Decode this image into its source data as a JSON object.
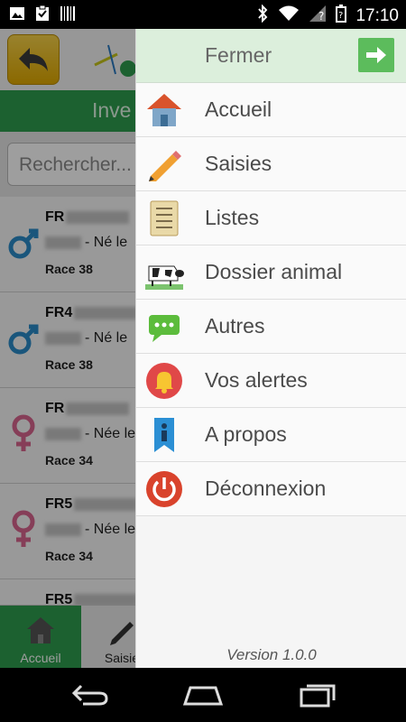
{
  "status_bar": {
    "time": "17:10",
    "left_icons": [
      "photo-icon",
      "clipboard-check-icon",
      "barcode-icon"
    ],
    "right_icons": [
      "bluetooth-icon",
      "wifi-icon",
      "signal-unknown-icon",
      "battery-unknown-icon"
    ]
  },
  "background_app": {
    "section_title": "Inve",
    "search_placeholder": "Rechercher...",
    "animals": [
      {
        "id_prefix": "FR",
        "birth": "- Né le",
        "race": "Race 38",
        "sex": "male"
      },
      {
        "id_prefix": "FR4",
        "birth": "- Né le",
        "race": "Race 38",
        "sex": "male"
      },
      {
        "id_prefix": "FR",
        "birth": "- Née le",
        "race": "Race 34",
        "sex": "female"
      },
      {
        "id_prefix": "FR5",
        "birth": "- Née le",
        "race": "Race 34",
        "sex": "female"
      },
      {
        "id_prefix": "FR5",
        "birth": "",
        "race": "",
        "sex": "female"
      }
    ],
    "tabs": [
      {
        "label": "Accueil",
        "icon": "home-icon",
        "active": true
      },
      {
        "label": "Saisie",
        "icon": "pencil-icon",
        "active": false
      }
    ]
  },
  "drawer": {
    "close_label": "Fermer",
    "items": [
      {
        "label": "Accueil",
        "icon": "house-icon"
      },
      {
        "label": "Saisies",
        "icon": "pencil-icon"
      },
      {
        "label": "Listes",
        "icon": "notepad-icon"
      },
      {
        "label": "Dossier animal",
        "icon": "cow-icon"
      },
      {
        "label": "Autres",
        "icon": "chat-bubble-icon"
      },
      {
        "label": "Vos alertes",
        "icon": "bell-icon"
      },
      {
        "label": "A propos",
        "icon": "info-icon"
      },
      {
        "label": "Déconnexion",
        "icon": "power-icon"
      }
    ],
    "version": "Version 1.0.0"
  },
  "colors": {
    "accent_green": "#2e9d4e",
    "drawer_header": "#dcefdc",
    "male_blue": "#2a8bc8",
    "female_pink": "#d9658f"
  }
}
